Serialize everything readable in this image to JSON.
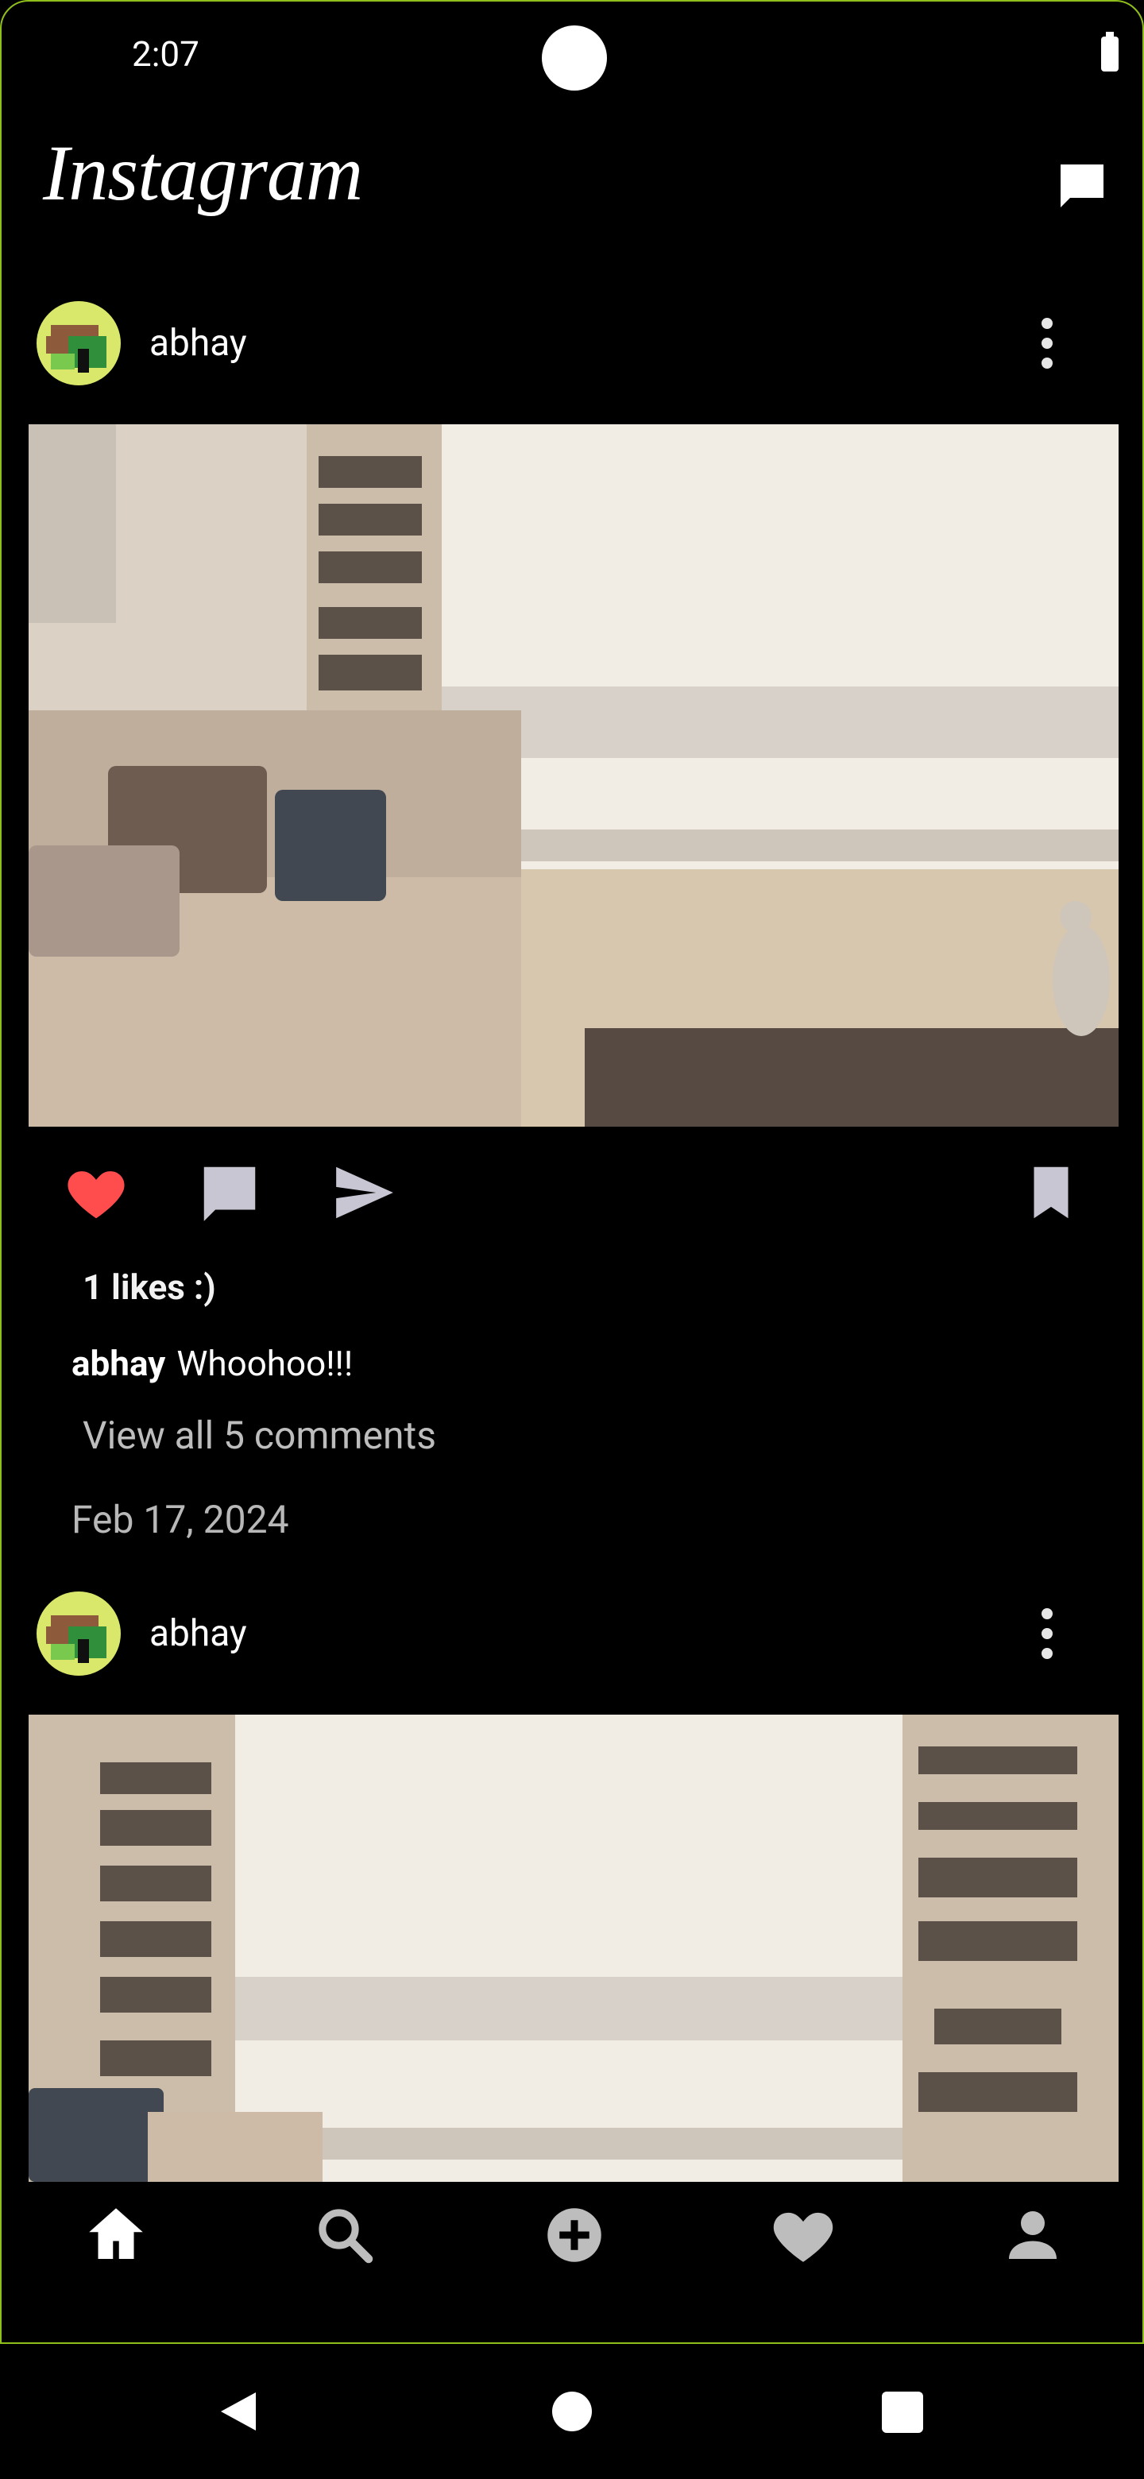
{
  "status_bar": {
    "time": "2:07"
  },
  "header": {
    "brand": "Instagram",
    "messages_icon": "messages-icon"
  },
  "posts": [
    {
      "username": "abhay",
      "liked": true,
      "likes_text": "1 likes :)",
      "caption_user": "abhay",
      "caption_text": "Whoohoo!!!",
      "view_comments": "View all 5 comments",
      "date": "Feb 17, 2024"
    },
    {
      "username": "abhay"
    }
  ],
  "bottom_nav": [
    "home-icon",
    "search-icon",
    "add-icon",
    "heart-icon",
    "profile-icon"
  ],
  "colors": {
    "like": "#ff4d4d",
    "accent_border": "#8fbf1a",
    "icon_gray": "#c9c6d3"
  }
}
